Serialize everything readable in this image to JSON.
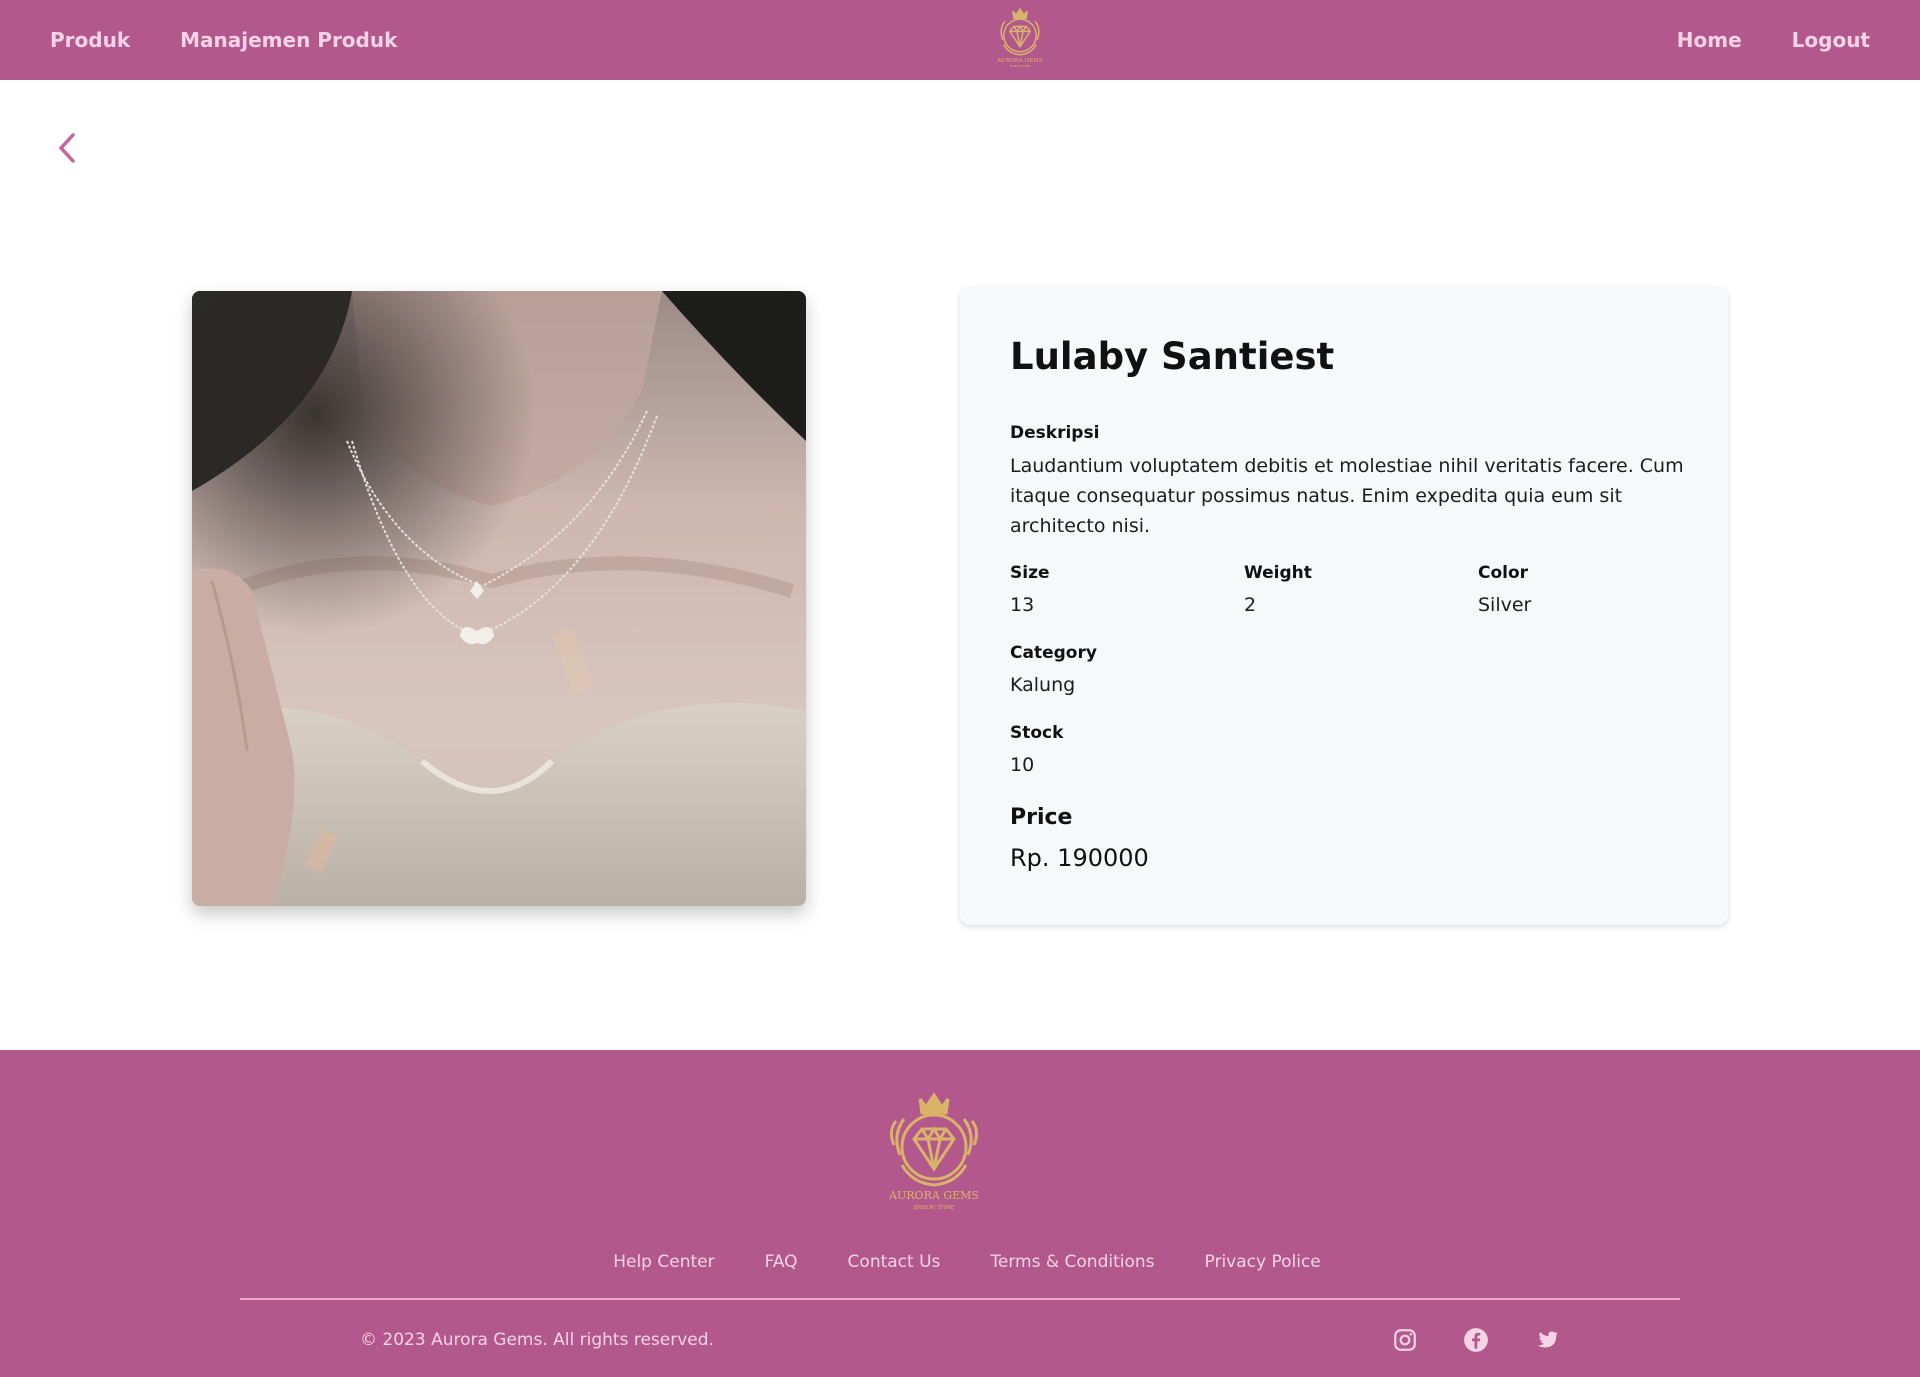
{
  "header": {
    "nav_left": [
      "Produk",
      "Manajemen Produk"
    ],
    "nav_right": [
      "Home",
      "Logout"
    ],
    "logo_text": "AURORA GEMS",
    "logo_subtext": "JEWELRY STORE"
  },
  "product": {
    "name": "Lulaby Santiest",
    "description_label": "Deskripsi",
    "description": "Laudantium voluptatem debitis et molestiae nihil veritatis facere. Cum itaque consequatur possimus natus. Enim expedita quia eum sit architecto nisi.",
    "size_label": "Size",
    "size": "13",
    "weight_label": "Weight",
    "weight": "2",
    "color_label": "Color",
    "color": "Silver",
    "category_label": "Category",
    "category": "Kalung",
    "stock_label": "Stock",
    "stock": "10",
    "price_label": "Price",
    "price": "Rp. 190000"
  },
  "footer": {
    "logo_text": "AURORA GEMS",
    "logo_subtext": "JEWELRY STORE",
    "links": [
      "Help Center",
      "FAQ",
      "Contact Us",
      "Terms & Conditions",
      "Privacy Police"
    ],
    "copyright": "© 2023 Aurora Gems. All rights reserved.",
    "social_icons": [
      "instagram-icon",
      "facebook-icon",
      "twitter-icon"
    ]
  },
  "theme": {
    "primary": "#b2588c",
    "nav_text": "#f6d3e6",
    "gold": "#d9b36a",
    "back_arrow": "#c563a0"
  }
}
